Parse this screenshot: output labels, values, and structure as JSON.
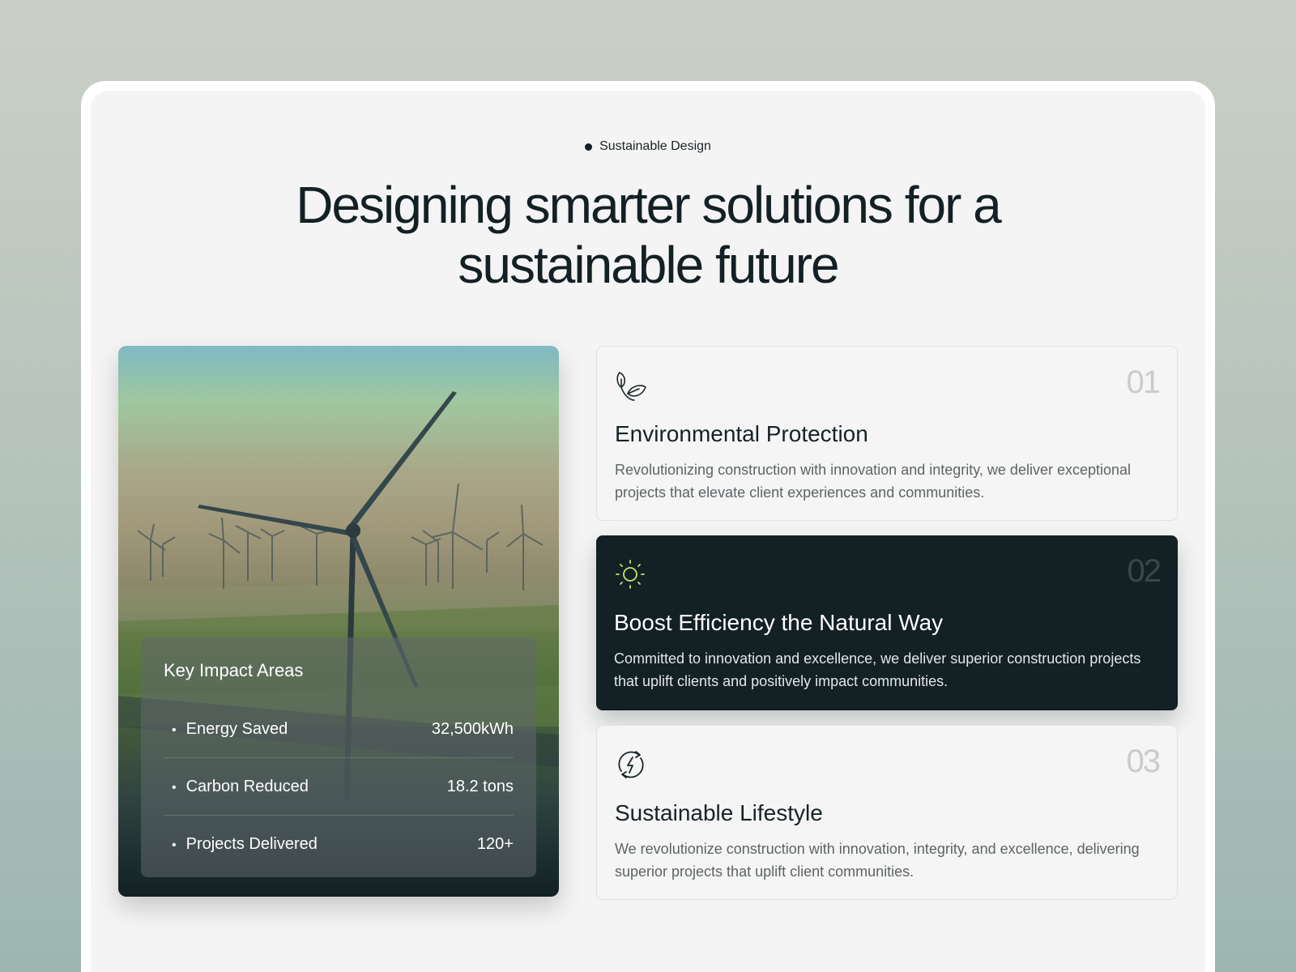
{
  "eyebrow": "Sustainable Design",
  "headline": {
    "line1": "Designing smarter solutions for a",
    "line2": "sustainable future"
  },
  "impact": {
    "title": "Key Impact Areas",
    "rows": [
      {
        "label": "Energy Saved",
        "value": "32,500kWh"
      },
      {
        "label": "Carbon Reduced",
        "value": "18.2 tons"
      },
      {
        "label": "Projects Delivered",
        "value": "120+"
      }
    ]
  },
  "features": [
    {
      "number": "01",
      "icon": "leaf-icon",
      "title": "Environmental Protection",
      "text": "Revolutionizing construction with innovation and integrity, we deliver exceptional projects that elevate client experiences and communities."
    },
    {
      "number": "02",
      "icon": "sun-icon",
      "title": "Boost Efficiency the Natural Way",
      "text": "Committed to innovation and excellence, we deliver superior construction projects that uplift clients and positively impact communities."
    },
    {
      "number": "03",
      "icon": "renewable-energy-icon",
      "title": "Sustainable Lifestyle",
      "text": "We revolutionize construction with innovation, integrity, and excellence, delivering superior projects that uplift client communities."
    }
  ],
  "colors": {
    "dark": "#132024",
    "accent": "#c8e66a",
    "panel": "#f4f4f4"
  }
}
